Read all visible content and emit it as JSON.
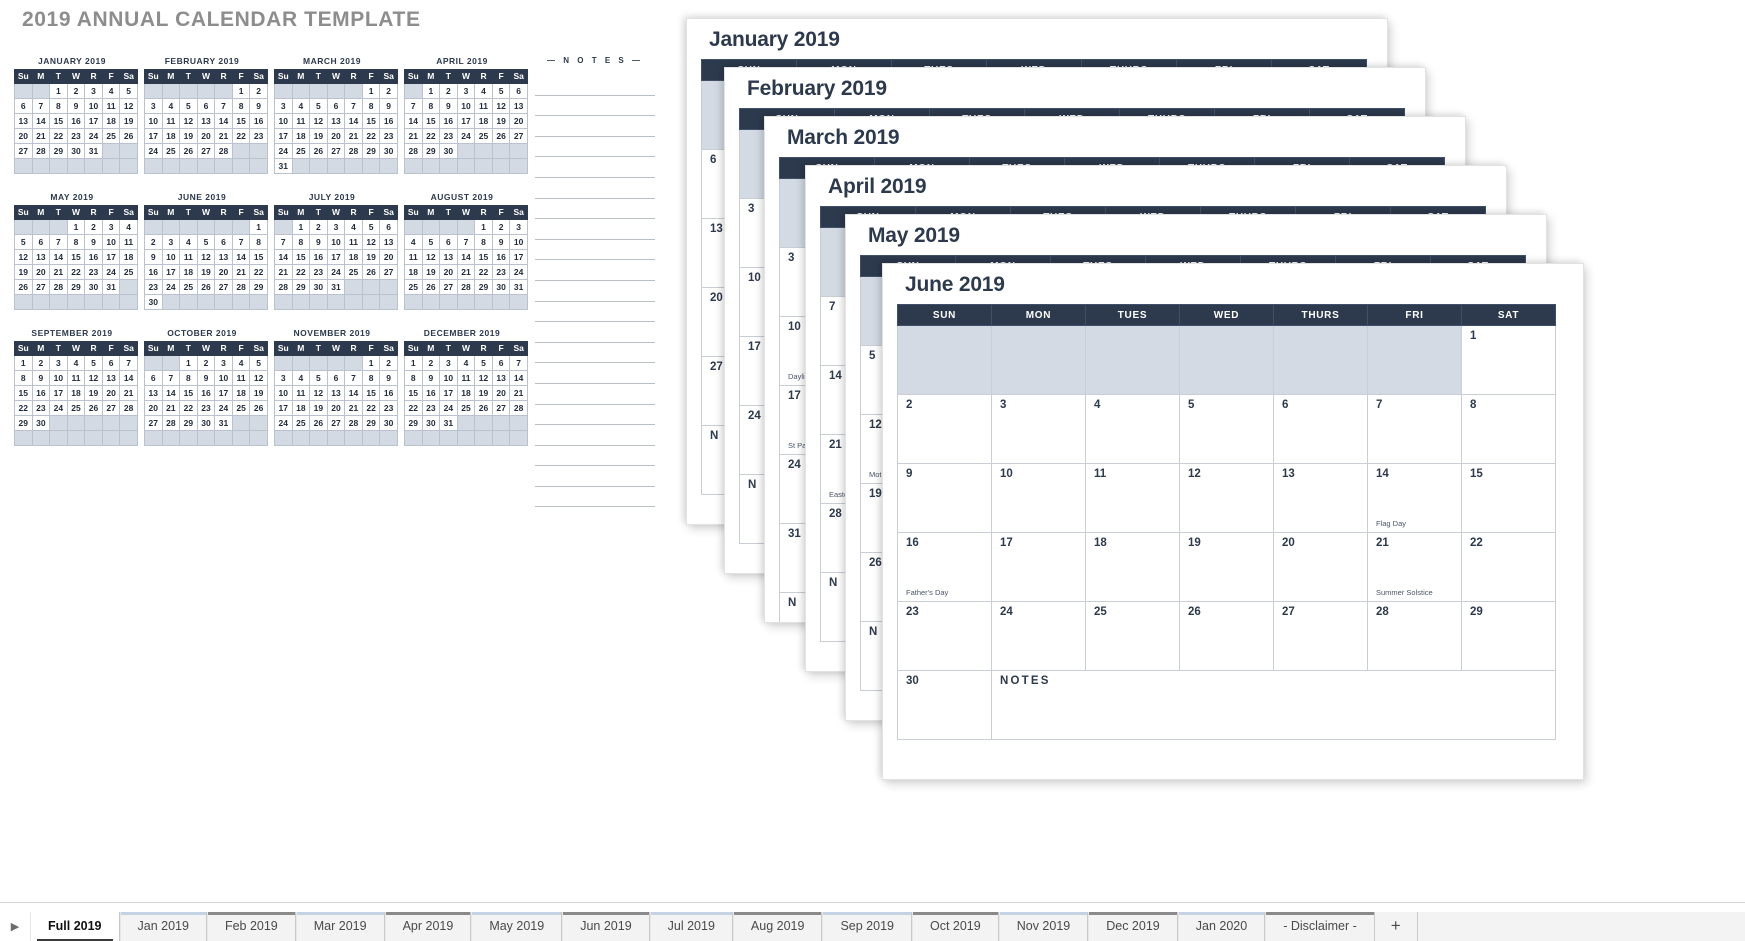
{
  "page_title": "2019 ANNUAL CALENDAR TEMPLATE",
  "notes_label": "— N O T E S —",
  "notes_line_count": 21,
  "mini_weekday_headers": [
    "Su",
    "M",
    "T",
    "W",
    "R",
    "F",
    "Sa"
  ],
  "mini_calendars": [
    {
      "title": "JANUARY 2019",
      "lead": 2,
      "days": 31
    },
    {
      "title": "FEBRUARY 2019",
      "lead": 5,
      "days": 28
    },
    {
      "title": "MARCH 2019",
      "lead": 5,
      "days": 31
    },
    {
      "title": "APRIL 2019",
      "lead": 1,
      "days": 30
    },
    {
      "title": "MAY 2019",
      "lead": 3,
      "days": 31
    },
    {
      "title": "JUNE 2019",
      "lead": 6,
      "days": 30
    },
    {
      "title": "JULY 2019",
      "lead": 1,
      "days": 31
    },
    {
      "title": "AUGUST 2019",
      "lead": 4,
      "days": 31
    },
    {
      "title": "SEPTEMBER 2019",
      "lead": 0,
      "days": 30
    },
    {
      "title": "OCTOBER 2019",
      "lead": 2,
      "days": 31
    },
    {
      "title": "NOVEMBER 2019",
      "lead": 5,
      "days": 30
    },
    {
      "title": "DECEMBER 2019",
      "lead": 0,
      "days": 31
    }
  ],
  "month_weekday_headers": [
    "SUN",
    "MON",
    "TUES",
    "WED",
    "THURS",
    "FRI",
    "SAT"
  ],
  "notes_cell_label": "NOTES",
  "sheets": [
    {
      "title": "January 2019",
      "stub_days": [
        "6",
        "13",
        "20",
        "27"
      ],
      "stub_notes": "N"
    },
    {
      "title": "February 2019",
      "stub_days": [
        "3",
        "10",
        "17",
        "24"
      ],
      "stub_notes": "N"
    },
    {
      "title": "March 2019",
      "stub_days": [
        "3",
        "10",
        "17",
        "24",
        "31"
      ],
      "stub_notes": "N",
      "stub_holidays": {
        "10": "Daylight Savings Time",
        "17": "St Patrick's Day"
      }
    },
    {
      "title": "April 2019",
      "stub_days": [
        "7",
        "14",
        "21",
        "28"
      ],
      "stub_notes": "N",
      "stub_holidays": {
        "21": "Easter"
      }
    },
    {
      "title": "May 2019",
      "stub_days": [
        "5",
        "12",
        "19",
        "26"
      ],
      "stub_notes": "N",
      "stub_holidays": {
        "12": "Mother's Day"
      }
    }
  ],
  "active_sheet": {
    "title": "June 2019",
    "lead_blanks": 6,
    "weeks": [
      [
        null,
        null,
        null,
        null,
        null,
        null,
        {
          "day": "1"
        }
      ],
      [
        {
          "day": "2"
        },
        {
          "day": "3"
        },
        {
          "day": "4"
        },
        {
          "day": "5"
        },
        {
          "day": "6"
        },
        {
          "day": "7"
        },
        {
          "day": "8"
        }
      ],
      [
        {
          "day": "9"
        },
        {
          "day": "10"
        },
        {
          "day": "11"
        },
        {
          "day": "12"
        },
        {
          "day": "13"
        },
        {
          "day": "14",
          "holiday": "Flag Day"
        },
        {
          "day": "15"
        }
      ],
      [
        {
          "day": "16",
          "holiday": "Father's Day"
        },
        {
          "day": "17"
        },
        {
          "day": "18"
        },
        {
          "day": "19"
        },
        {
          "day": "20"
        },
        {
          "day": "21",
          "holiday": "Summer Solstice"
        },
        {
          "day": "22"
        }
      ],
      [
        {
          "day": "23"
        },
        {
          "day": "24"
        },
        {
          "day": "25"
        },
        {
          "day": "26"
        },
        {
          "day": "27"
        },
        {
          "day": "28"
        },
        {
          "day": "29"
        }
      ]
    ],
    "last_day": "30"
  },
  "tabbar": {
    "scroll_icon": "play-right-icon",
    "add_label": "+",
    "tabs": [
      {
        "label": "Full 2019",
        "active": true,
        "accent": "none"
      },
      {
        "label": "Jan 2019",
        "active": false,
        "accent": "blue"
      },
      {
        "label": "Feb 2019",
        "active": false,
        "accent": "gray"
      },
      {
        "label": "Mar 2019",
        "active": false,
        "accent": "blue"
      },
      {
        "label": "Apr 2019",
        "active": false,
        "accent": "gray"
      },
      {
        "label": "May 2019",
        "active": false,
        "accent": "blue"
      },
      {
        "label": "Jun 2019",
        "active": false,
        "accent": "gray"
      },
      {
        "label": "Jul 2019",
        "active": false,
        "accent": "blue"
      },
      {
        "label": "Aug 2019",
        "active": false,
        "accent": "gray"
      },
      {
        "label": "Sep 2019",
        "active": false,
        "accent": "blue"
      },
      {
        "label": "Oct 2019",
        "active": false,
        "accent": "gray"
      },
      {
        "label": "Nov 2019",
        "active": false,
        "accent": "blue"
      },
      {
        "label": "Dec 2019",
        "active": false,
        "accent": "gray"
      },
      {
        "label": "Jan 2020",
        "active": false,
        "accent": "blue"
      },
      {
        "label": "- Disclaimer -",
        "active": false,
        "accent": "gray"
      }
    ]
  },
  "colors": {
    "header_navy": "#2d3a4d",
    "blank_cell": "#d3dae4",
    "title_gray": "#8d8d8d",
    "notes_bg": "#eeeeee"
  }
}
